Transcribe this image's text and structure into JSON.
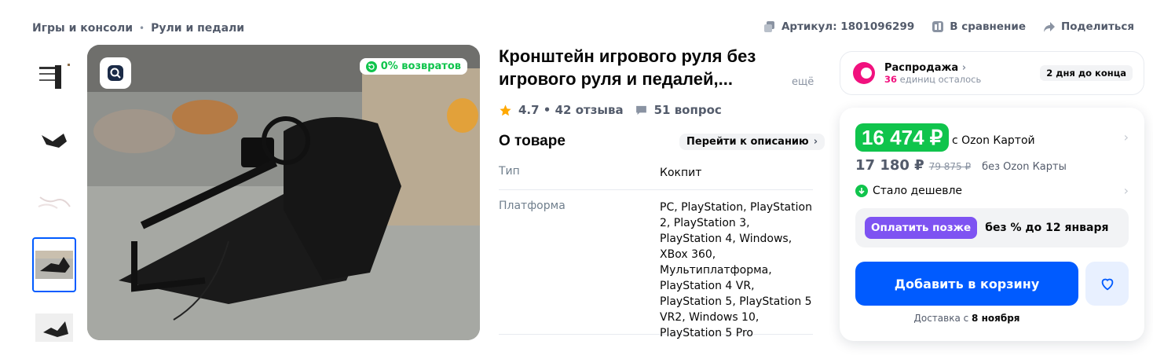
{
  "breadcrumbs": [
    "Игры и консоли",
    "Рули и педали"
  ],
  "breadcrumb_sep": "•",
  "top_actions": {
    "article": "Артикул: 1801096299",
    "compare": "В сравнение",
    "share": "Поделиться"
  },
  "photo": {
    "returns_badge": "0% возвратов",
    "search_icon": "image-search-icon"
  },
  "product": {
    "title_line1": "Кронштейн игрового руля без",
    "title_line2": "игрового руля и педалей,...",
    "more": "ещё",
    "rating_text": "4.7 • 42 отзыва",
    "questions": "51 вопрос"
  },
  "about": {
    "heading": "О товаре",
    "goto": "Перейти к описанию",
    "rows": [
      {
        "key": "Тип",
        "value": "Кокпит"
      },
      {
        "key": "Платформа",
        "value": "PC, PlayStation, PlayStation 2, PlayStation 3, PlayStation 4, Windows, XBox 360, Мультиплатформа, PlayStation 4 VR, PlayStation 5, PlayStation 5 VR2, Windows 10, PlayStation 5 Pro"
      }
    ]
  },
  "sale": {
    "title": "Распродажа",
    "count": "36",
    "left_text": " единиц осталось",
    "days": "2 дня до конца"
  },
  "price": {
    "card_price": "16 474 ₽",
    "card_label": "с Ozon Картой",
    "regular_price": "17 180 ₽",
    "old_price": "79 875 ₽",
    "regular_label": "без Ozon Карты",
    "cheaper": "Стало дешевле",
    "pay_later_button": "Оплатить позже",
    "pay_later_text": "без % до 12 января",
    "cart_button": "Добавить в корзину",
    "delivery_prefix": "Доставка с ",
    "delivery_date": "8 ноября"
  },
  "colors": {
    "accent": "#005bff",
    "green": "#10c44c",
    "pink": "#f1117e",
    "purple": "#7e53f2"
  }
}
